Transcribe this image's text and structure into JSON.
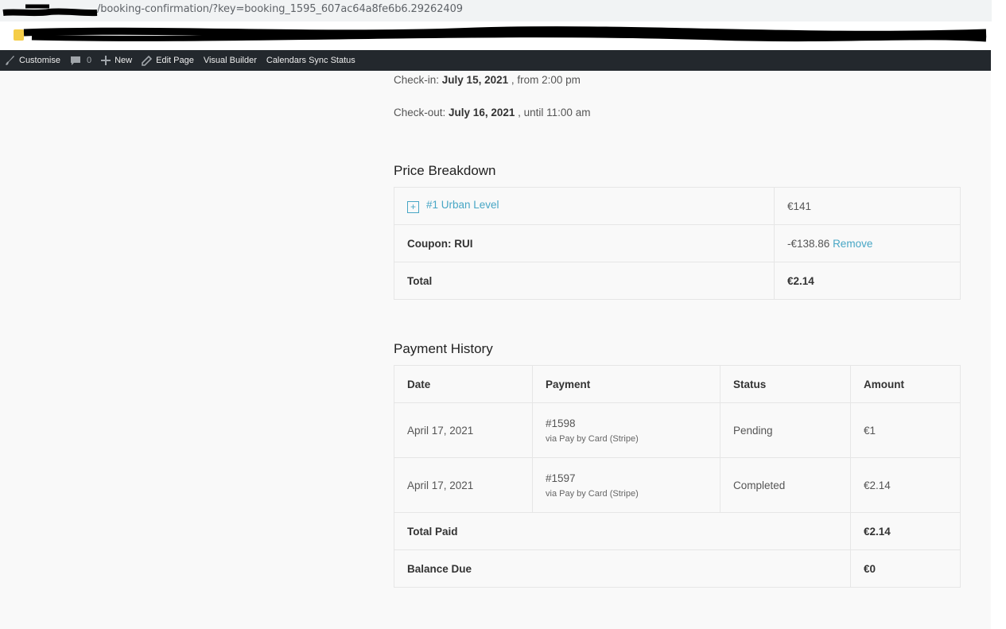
{
  "browser": {
    "url": "/booking-confirmation/?key=booking_1595_607ac64a8fe6b6.29262409"
  },
  "admin_bar": {
    "items": [
      {
        "label": "Customise",
        "icon": "paintbrush-icon"
      },
      {
        "label": "0",
        "icon": "comment-icon"
      },
      {
        "label": "New",
        "icon": "plus-icon"
      },
      {
        "label": "Edit Page",
        "icon": "pencil-icon"
      },
      {
        "label": "Visual Builder"
      },
      {
        "label": "Calendars Sync Status"
      }
    ]
  },
  "booking": {
    "checkin_label": "Check-in:",
    "checkin_date": "July 15, 2021",
    "checkin_time": ", from 2:00 pm",
    "checkout_label": "Check-out:",
    "checkout_date": "July 16, 2021",
    "checkout_time": ", until 11:00 am"
  },
  "price_breakdown": {
    "title": "Price Breakdown",
    "expand_symbol": "+",
    "item_label": "#1 Urban Level",
    "item_price": "€141",
    "coupon_label": "Coupon: RUI",
    "coupon_value": "-€138.86",
    "coupon_remove": "Remove",
    "total_label": "Total",
    "total_value": "€2.14"
  },
  "payment_history": {
    "title": "Payment History",
    "headers": [
      "Date",
      "Payment",
      "Status",
      "Amount"
    ],
    "rows": [
      {
        "date": "April 17, 2021",
        "payment": "#1598",
        "method": "via Pay by Card (Stripe)",
        "status": "Pending",
        "amount": "€1"
      },
      {
        "date": "April 17, 2021",
        "payment": "#1597",
        "method": "via Pay by Card (Stripe)",
        "status": "Completed",
        "amount": "€2.14"
      }
    ],
    "total_paid_label": "Total Paid",
    "total_paid_value": "€2.14",
    "balance_due_label": "Balance Due",
    "balance_due_value": "€0"
  },
  "colors": {
    "admin_bar": "#23282d",
    "link": "#47a6c5",
    "page_bg": "#f9f9f9"
  }
}
